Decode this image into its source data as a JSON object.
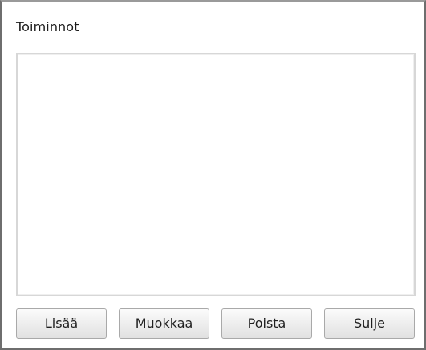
{
  "window": {
    "title": "Toiminnot"
  },
  "list": {
    "items": []
  },
  "buttons": {
    "add": "Lisää",
    "edit": "Muokkaa",
    "delete": "Poista",
    "close": "Sulje"
  }
}
